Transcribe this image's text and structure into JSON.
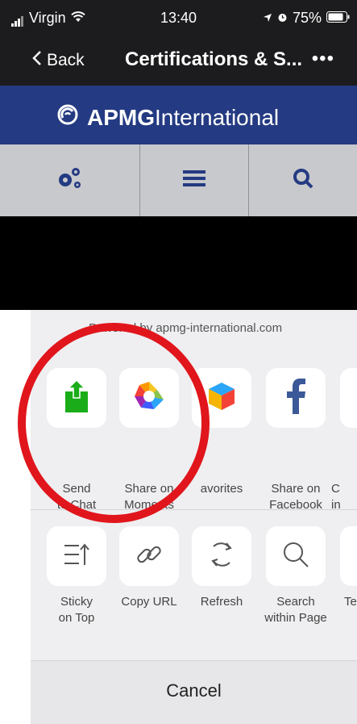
{
  "status_bar": {
    "carrier": "Virgin",
    "time": "13:40",
    "battery": "75%"
  },
  "nav": {
    "back_label": "Back",
    "title": "Certifications & S...",
    "more": "•••"
  },
  "web": {
    "brand_bold": "APMG",
    "brand_light": "International"
  },
  "share_sheet": {
    "header": "Powered by apmg-international.com",
    "row1": [
      {
        "label": "Send\nto Chat",
        "icon": "send-to-chat-icon"
      },
      {
        "label": "Share on\nMoments",
        "icon": "moments-aperture-icon"
      },
      {
        "label": "avorites",
        "icon": "favorites-cube-icon"
      },
      {
        "label": "Share on\nFacebook",
        "icon": "facebook-icon"
      },
      {
        "label": "C\nin",
        "icon": "partial-icon"
      }
    ],
    "row2": [
      {
        "label": "Sticky\non Top",
        "icon": "sticky-on-top-icon"
      },
      {
        "label": "Copy URL",
        "icon": "link-icon"
      },
      {
        "label": "Refresh",
        "icon": "refresh-icon"
      },
      {
        "label": "Search\nwithin Page",
        "icon": "search-icon"
      },
      {
        "label": "Te",
        "icon": "partial-icon"
      }
    ],
    "cancel": "Cancel"
  },
  "colors": {
    "nav_bg": "#1c1c1e",
    "brand_bar": "#243a82",
    "highlight": "#e0161c"
  }
}
